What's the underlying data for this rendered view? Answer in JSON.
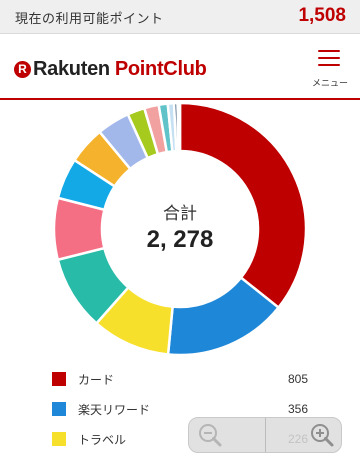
{
  "points_bar": {
    "label": "現在の利用可能ポイント",
    "value": "1,508"
  },
  "header": {
    "logo_mark": "R",
    "logo_word": "Rakuten",
    "logo_point": "PointClub",
    "menu_label": "メニュー",
    "menu_icon": "hamburger-icon"
  },
  "summary": {
    "total_label": "合計",
    "total_value": "2, 278"
  },
  "chart_data": {
    "type": "pie",
    "total": 2278,
    "slices": [
      {
        "label": "カード",
        "value": 805,
        "color": "#bf0000"
      },
      {
        "label": "楽天リワード",
        "value": 356,
        "color": "#1e87d8"
      },
      {
        "label": "トラベル",
        "value": 226,
        "color": "#f7e02c"
      },
      {
        "value": 215,
        "color": "#28bba7"
      },
      {
        "value": 178,
        "color": "#f56f84"
      },
      {
        "value": 118,
        "color": "#13a9e6"
      },
      {
        "value": 108,
        "color": "#f5b22c"
      },
      {
        "value": 95,
        "color": "#a3b8ea"
      },
      {
        "value": 50,
        "color": "#a7ca1e"
      },
      {
        "value": 42,
        "color": "#f2a1a1"
      },
      {
        "value": 26,
        "color": "#5fc3c9"
      },
      {
        "value": 18,
        "color": "#c6e0f3"
      },
      {
        "value": 10,
        "color": "#3c5a78"
      },
      {
        "value": 7,
        "color": "#e9e9e9"
      }
    ]
  },
  "legend": [
    {
      "label": "カード",
      "value": "805",
      "color": "#bf0000"
    },
    {
      "label": "楽天リワード",
      "value": "356",
      "color": "#1e87d8"
    },
    {
      "label": "トラベル",
      "value": "226",
      "color": "#f7e02c"
    }
  ],
  "zoom": {
    "zoom_out_icon": "zoom-out-icon",
    "zoom_in_icon": "zoom-in-icon"
  }
}
